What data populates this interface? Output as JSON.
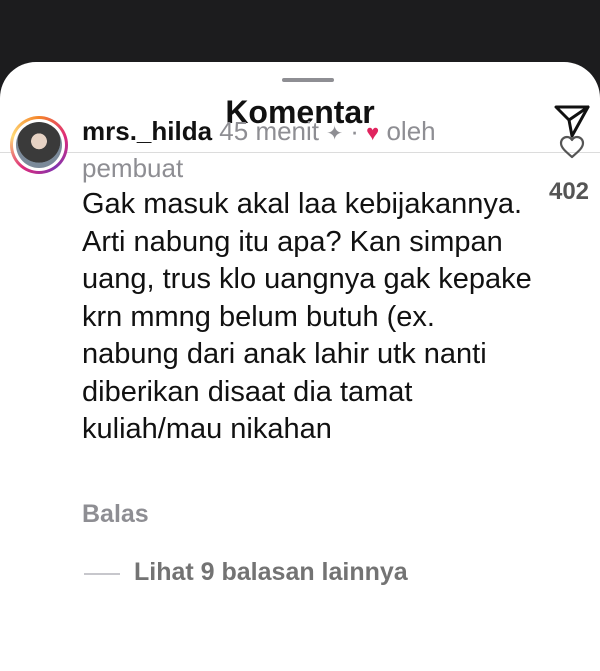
{
  "header": {
    "title": "Komentar",
    "share_icon": "paper-plane-icon"
  },
  "comment": {
    "username": "mrs._hilda",
    "time": "45 menit",
    "pinned_icon": "pin-icon",
    "separator": "·",
    "liked_by_creator": "♥",
    "liked_by_label": "oleh pembuat",
    "text": "Gak masuk akal laa kebijakannya. Arti nabung itu apa? Kan simpan uang, trus klo uangnya gak kepake krn mmng belum butuh (ex. nabung dari anak lahir utk nanti diberikan disaat dia tamat kuliah/mau nikahan",
    "reply_label": "Balas",
    "like_count": "402",
    "view_more_label": "Lihat 9 balasan lainnya"
  },
  "colors": {
    "creator_heart": "#e0245e",
    "sheet": "#ffffff",
    "backdrop": "#1c1c1e"
  }
}
